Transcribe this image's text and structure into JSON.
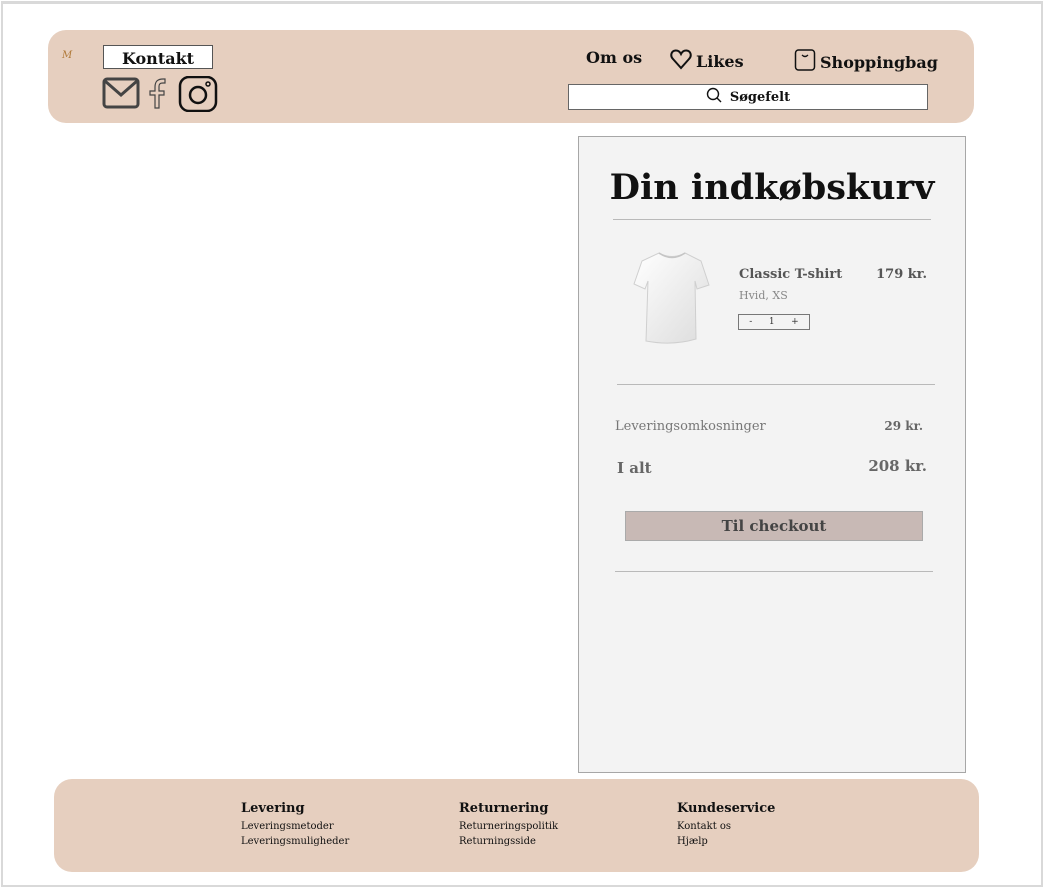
{
  "header": {
    "logo": "M",
    "contact_label": "Kontakt",
    "nav": {
      "about": "Om os",
      "likes": "Likes",
      "bag": "Shoppingbag"
    },
    "search_label": "Søgefelt",
    "social_icons": [
      "mail-icon",
      "facebook-icon",
      "instagram-icon"
    ]
  },
  "cart": {
    "title": "Din indkøbskurv",
    "item": {
      "name": "Classic T-shirt",
      "variant": "Hvid, XS",
      "price": "179 kr.",
      "quantity": "1",
      "minus": "-",
      "plus": "+"
    },
    "shipping_label": "Leveringsomkosninger",
    "shipping_price": "29 kr.",
    "total_label": "I alt",
    "total_price": "208 kr.",
    "checkout_label": "Til checkout"
  },
  "footer": {
    "columns": [
      {
        "heading": "Levering",
        "links": [
          "Leveringsmetoder",
          "Leveringsmuligheder"
        ]
      },
      {
        "heading": "Returnering",
        "links": [
          "Returneringspolitik",
          "Returningsside"
        ]
      },
      {
        "heading": "Kundeservice",
        "links": [
          "Kontakt os",
          "Hjælp"
        ]
      }
    ]
  },
  "colors": {
    "accent_bg": "#e6cfbf",
    "panel_bg": "#f3f3f3",
    "checkout_bg": "#c8b9b5"
  }
}
